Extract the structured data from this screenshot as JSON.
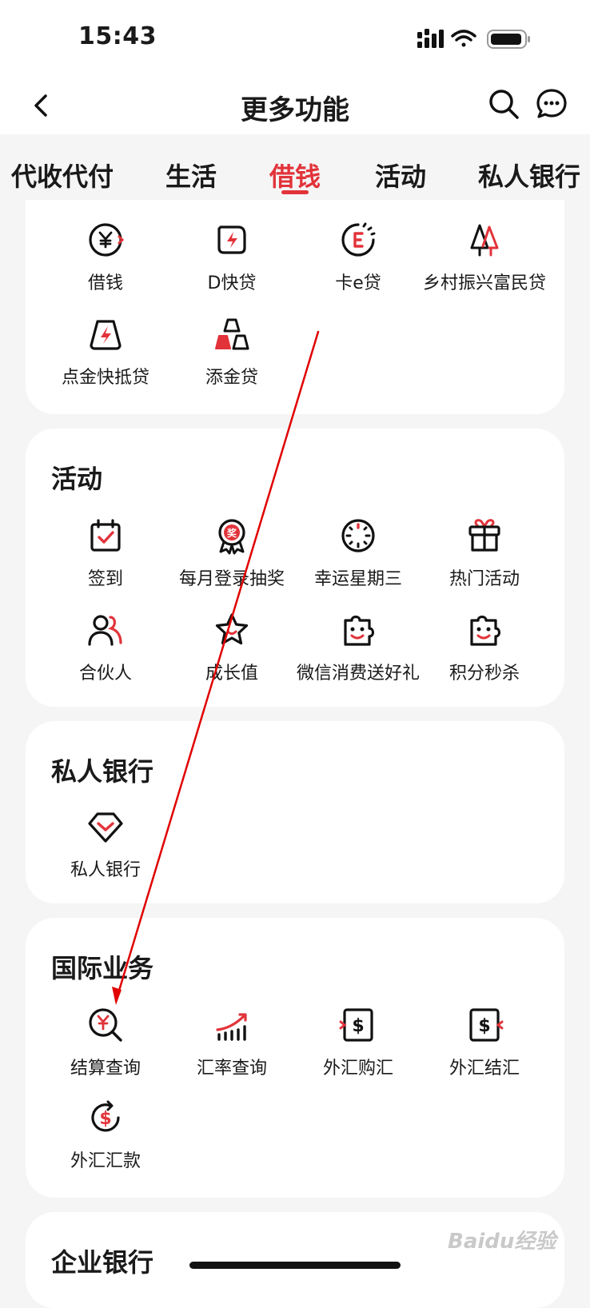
{
  "status_bar": {
    "time": "15:43"
  },
  "nav": {
    "title": "更多功能"
  },
  "tabs": [
    "代收代付",
    "生活",
    "借钱",
    "活动",
    "私人银行"
  ],
  "active_tab": "借钱",
  "colors": {
    "accent": "#e2333a",
    "background": "#f5f5f5",
    "card": "#ffffff",
    "text": "#1a1a1a",
    "annotation_arrow": "#e00000"
  },
  "loan_section": {
    "items": [
      {
        "label": "借钱",
        "icon": "yen-coin-icon"
      },
      {
        "label": "D快贷",
        "icon": "lightning-badge-icon"
      },
      {
        "label": "卡e贷",
        "icon": "e-circle-icon"
      },
      {
        "label": "乡村振兴富民贷",
        "icon": "trees-icon"
      },
      {
        "label": "点金快抵贷",
        "icon": "gold-bar-lightning-icon"
      },
      {
        "label": "添金贷",
        "icon": "gold-stack-icon"
      }
    ]
  },
  "activity_section": {
    "title": "活动",
    "items": [
      {
        "label": "签到",
        "icon": "calendar-check-icon"
      },
      {
        "label": "每月登录抽奖",
        "icon": "award-medal-icon"
      },
      {
        "label": "幸运星期三",
        "icon": "clock-dial-icon"
      },
      {
        "label": "热门活动",
        "icon": "gift-icon"
      },
      {
        "label": "合伙人",
        "icon": "partner-users-icon"
      },
      {
        "label": "成长值",
        "icon": "star-icon"
      },
      {
        "label": "微信消费送好礼",
        "icon": "smile-puzzle-icon"
      },
      {
        "label": "积分秒杀",
        "icon": "smile-puzzle-icon"
      }
    ]
  },
  "private_bank_section": {
    "title": "私人银行",
    "items": [
      {
        "label": "私人银行",
        "icon": "diamond-shield-icon"
      }
    ]
  },
  "intl_section": {
    "title": "国际业务",
    "items": [
      {
        "label": "结算查询",
        "icon": "yen-search-icon"
      },
      {
        "label": "汇率查询",
        "icon": "rate-chart-icon"
      },
      {
        "label": "外汇购汇",
        "icon": "dollar-in-icon"
      },
      {
        "label": "外汇结汇",
        "icon": "dollar-out-icon"
      },
      {
        "label": "外汇汇款",
        "icon": "dollar-cycle-icon"
      }
    ]
  },
  "enterprise_section": {
    "title": "企业银行"
  },
  "watermark": "Baidu经验"
}
